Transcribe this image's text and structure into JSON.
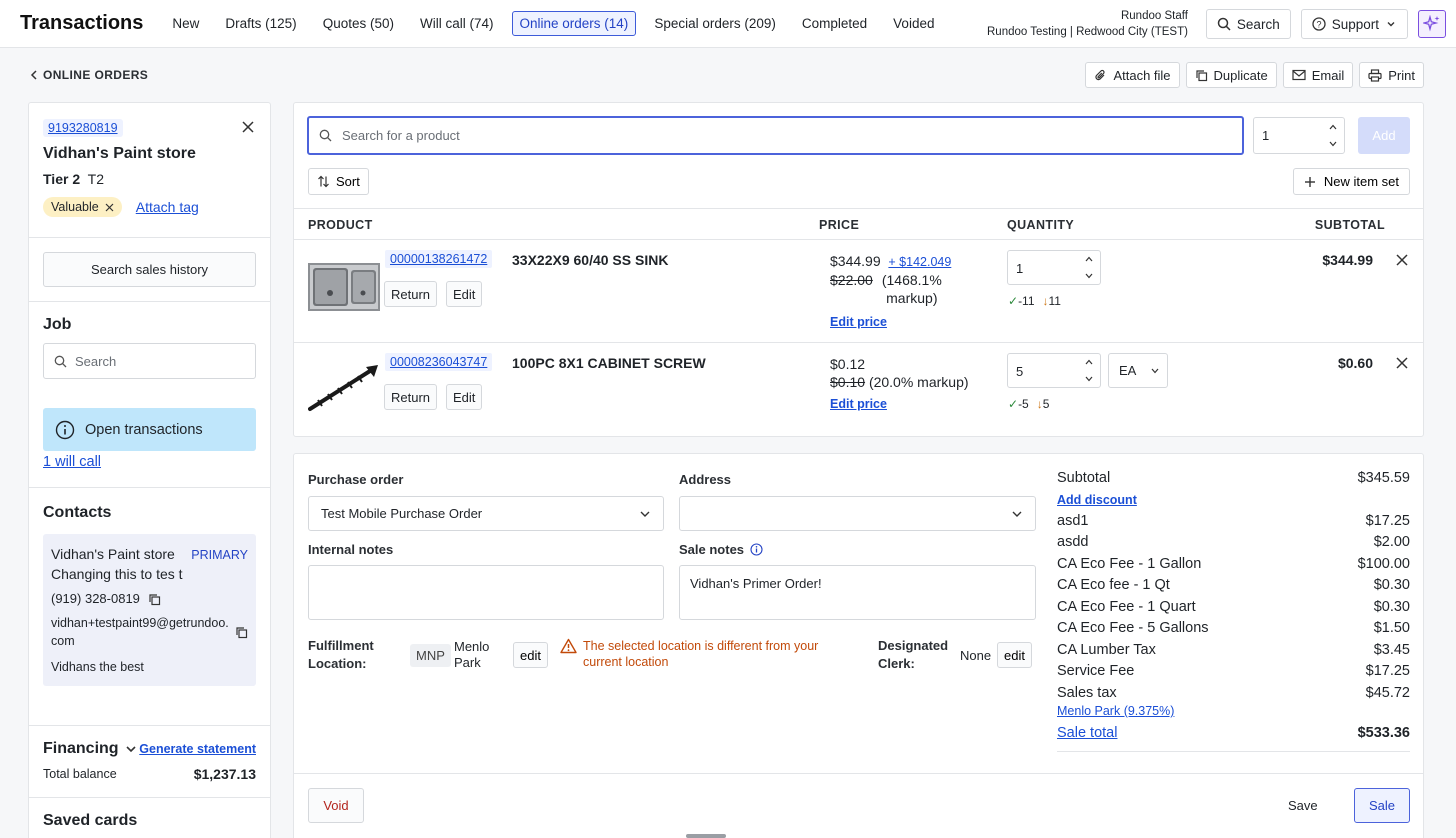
{
  "header": {
    "title": "Transactions",
    "tabs": [
      {
        "label": "New"
      },
      {
        "label": "Drafts (125)"
      },
      {
        "label": "Quotes (50)"
      },
      {
        "label": "Will call (74)"
      },
      {
        "label": "Online orders (14)"
      },
      {
        "label": "Special orders (209)"
      },
      {
        "label": "Completed"
      },
      {
        "label": "Voided"
      }
    ],
    "active_tab": "Online orders (14)",
    "user_name": "Rundoo Staff",
    "user_org": "Rundoo Testing | Redwood City (TEST)",
    "search_label": "Search",
    "support_label": "Support"
  },
  "page": {
    "back_label": "ONLINE ORDERS",
    "actions": {
      "attach_file": "Attach file",
      "duplicate": "Duplicate",
      "email": "Email",
      "print": "Print"
    }
  },
  "customer": {
    "phone": "9193280819",
    "name": "Vidhan's Paint store",
    "tier_label": "Tier 2",
    "tier_code": "T2",
    "tag": "Valuable",
    "attach_tag": "Attach tag",
    "search_history": "Search sales history",
    "job_heading": "Job",
    "job_search_placeholder": "Search",
    "open_transactions": "Open transactions",
    "will_call_link": "1 will call",
    "contacts_heading": "Contacts",
    "contact": {
      "name": "Vidhan's Paint store Changing this to tes t",
      "badge": "PRIMARY",
      "phone": "(919) 328-0819",
      "email": "vidhan+testpaint99@getrundoo.com",
      "note": "Vidhans the best"
    },
    "financing_heading": "Financing",
    "generate_statement": "Generate statement",
    "total_balance_label": "Total balance",
    "total_balance": "$1,237.13",
    "saved_cards_heading": "Saved cards"
  },
  "product_search": {
    "placeholder": "Search for a product",
    "quantity": "1",
    "add_label": "Add",
    "sort_label": "Sort",
    "new_item_set_label": "New item set"
  },
  "table": {
    "columns": [
      "PRODUCT",
      "PRICE",
      "QUANTITY",
      "SUBTOTAL"
    ],
    "rows": [
      {
        "sku": "00000138261472",
        "name": "33X22X9 60/40 SS SINK",
        "return_label": "Return",
        "edit_label": "Edit",
        "price": "$344.99",
        "price_delta": "+ $142.049",
        "cost": "$22.00",
        "markup": "(1468.1% markup)",
        "edit_price": "Edit price",
        "quantity": "1",
        "stock_in": "-11",
        "stock_out": "11",
        "subtotal": "$344.99"
      },
      {
        "sku": "00008236043747",
        "name": "100PC 8X1 CABINET SCREW",
        "return_label": "Return",
        "edit_label": "Edit",
        "price": "$0.12",
        "cost": "$0.10",
        "markup": "(20.0% markup)",
        "edit_price": "Edit price",
        "quantity": "5",
        "uom": "EA",
        "stock_in": "-5",
        "stock_out": "5",
        "subtotal": "$0.60"
      }
    ]
  },
  "order": {
    "purchase_order_label": "Purchase order",
    "purchase_order_value": "Test Mobile Purchase Order",
    "address_label": "Address",
    "address_value": "",
    "internal_notes_label": "Internal notes",
    "internal_notes_value": "",
    "sale_notes_label": "Sale notes",
    "sale_notes_value": "Vidhan's Primer Order!",
    "fulfillment_label_1": "Fulfillment",
    "fulfillment_label_2": "Location:",
    "fulfillment_code": "MNP",
    "fulfillment_name_1": "Menlo",
    "fulfillment_name_2": "Park",
    "edit_label": "edit",
    "warning_1": "The selected location is different from your",
    "warning_2": "current location",
    "clerk_label_1": "Designated",
    "clerk_label_2": "Clerk:",
    "clerk_value": "None"
  },
  "totals": {
    "subtotal_label": "Subtotal",
    "subtotal": "$345.59",
    "add_discount": "Add discount",
    "fees": [
      {
        "label": "asd1",
        "amount": "$17.25"
      },
      {
        "label": "asdd",
        "amount": "$2.00"
      },
      {
        "label": "CA Eco Fee - 1 Gallon",
        "amount": "$100.00"
      },
      {
        "label": "CA Eco fee - 1 Qt",
        "amount": "$0.30"
      },
      {
        "label": "CA Eco Fee - 1 Quart",
        "amount": "$0.30"
      },
      {
        "label": "CA Eco Fee - 5 Gallons",
        "amount": "$1.50"
      },
      {
        "label": "CA Lumber Tax",
        "amount": "$3.45"
      },
      {
        "label": "Service Fee",
        "amount": "$17.25"
      },
      {
        "label": "Sales tax",
        "amount": "$45.72"
      }
    ],
    "tax_location": "Menlo Park (9.375%)",
    "sale_total_label": "Sale total",
    "sale_total": "$533.36"
  },
  "footer": {
    "void_label": "Void",
    "save_label": "Save",
    "sale_label": "Sale"
  },
  "colors": {
    "accent": "#4c63db",
    "link": "#1b4fd6",
    "warning": "#c24a0a",
    "info_bg": "#bfe6fb",
    "tag_bg": "#fdf0c4"
  }
}
